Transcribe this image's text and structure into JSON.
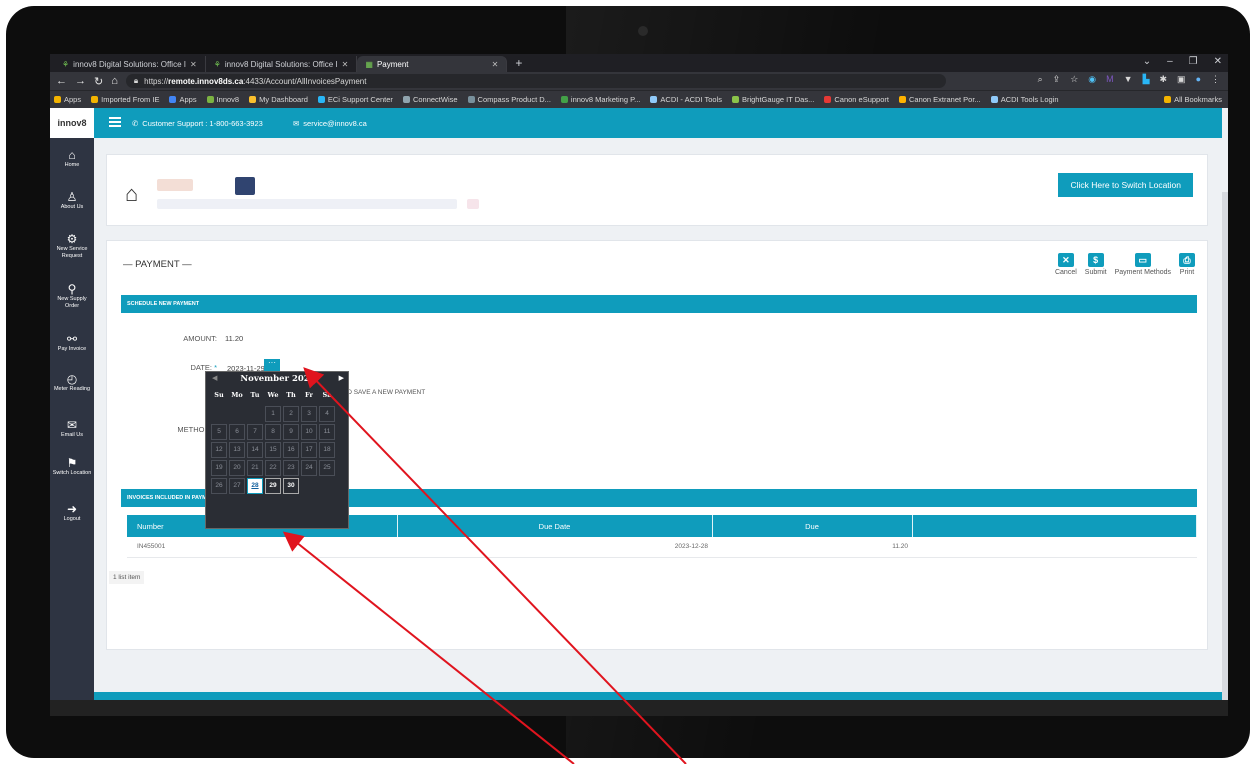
{
  "browser": {
    "tabs": [
      {
        "title": "innov8 Digital Solutions: Office I"
      },
      {
        "title": "innov8 Digital Solutions: Office I"
      },
      {
        "title": "Payment"
      }
    ],
    "url_prefix": "https://",
    "url_domain": "remote.innov8ds.ca",
    "url_path": ":4433/Account/AllInvoicesPayment",
    "bookmarks": [
      "Apps",
      "Imported From IE",
      "Apps",
      "Innov8",
      "My Dashboard",
      "ECi Support Center",
      "ConnectWise",
      "Compass Product D...",
      "innov8 Marketing P...",
      "ACDI - ACDI Tools",
      "BrightGauge IT Das...",
      "Canon eSupport",
      "Canon Extranet Por...",
      "ACDI Tools Login",
      "All Bookmarks"
    ]
  },
  "app": {
    "logo": "innov8",
    "support_phone": "Customer Support : 1-800-663-3923",
    "support_email": "service@innov8.ca",
    "switch_location": "Click Here to Switch Location",
    "sidebar": [
      {
        "label": "Home",
        "icon": "home-icon"
      },
      {
        "label": "About Us",
        "icon": "user-icon"
      },
      {
        "label": "New Service Request",
        "icon": "wrench-icon"
      },
      {
        "label": "New Supply Order",
        "icon": "cart-icon"
      },
      {
        "label": "Pay Invoice",
        "icon": "handshake-icon"
      },
      {
        "label": "Meter Reading",
        "icon": "gauge-icon"
      },
      {
        "label": "Email Us",
        "icon": "mail-icon"
      },
      {
        "label": "Switch Location",
        "icon": "location-icon"
      },
      {
        "label": "Logout",
        "icon": "logout-icon"
      }
    ]
  },
  "payment": {
    "title": "— PAYMENT —",
    "toolbar": [
      "Cancel",
      "Submit",
      "Payment Methods",
      "Print"
    ],
    "schedule_header": "SCHEDULE NEW PAYMENT",
    "amount_label": "AMOUNT:",
    "amount_value": "11.20",
    "date_label": "DATE:",
    "date_value": "2023-11-29",
    "method_label": "METHOD:",
    "add_link": "ADD AND SAVE A NEW PAYMENT",
    "invoices_header": "INVOICES INCLUDED IN PAYM",
    "table_headers": [
      "Number",
      "Due Date",
      "Due"
    ],
    "rows": [
      {
        "number": "IN455001",
        "due_date": "2023-12-28",
        "due": "11.20"
      }
    ],
    "list_count": "1 list item"
  },
  "datepicker": {
    "month": "November 2023",
    "dow": [
      "Su",
      "Mo",
      "Tu",
      "We",
      "Th",
      "Fr",
      "Sa"
    ],
    "days": [
      "1",
      "2",
      "3",
      "4",
      "5",
      "6",
      "7",
      "8",
      "9",
      "10",
      "11",
      "12",
      "13",
      "14",
      "15",
      "16",
      "17",
      "18",
      "19",
      "20",
      "21",
      "22",
      "23",
      "24",
      "25",
      "26",
      "27",
      "28",
      "29",
      "30"
    ],
    "selected": "28",
    "first_weekday": 3
  },
  "colors": {
    "accent": "#0f9cbc",
    "sidebar": "#2e3442",
    "annotation": "#e0141e"
  }
}
